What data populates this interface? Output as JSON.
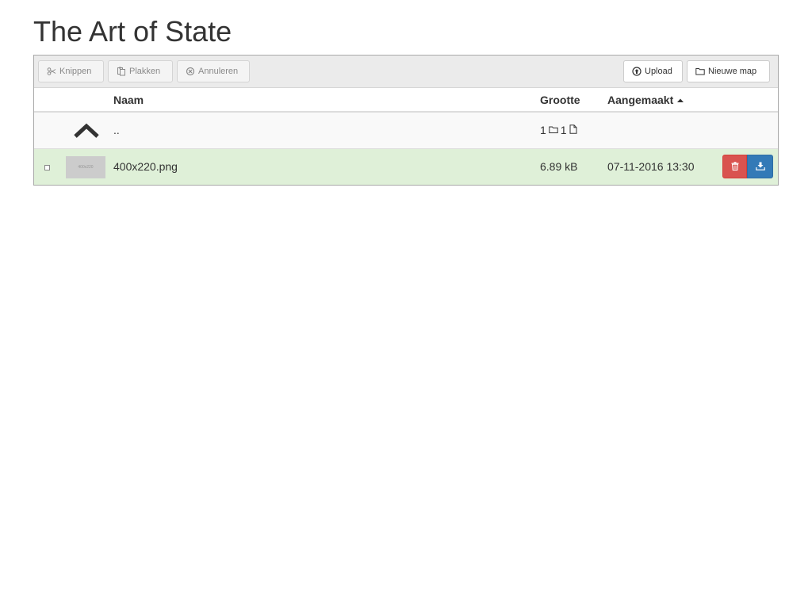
{
  "page": {
    "title": "The Art of State"
  },
  "toolbar": {
    "cut_label": "Knippen",
    "paste_label": "Plakken",
    "cancel_label": "Annuleren",
    "upload_label": "Upload",
    "new_folder_label": "Nieuwe map"
  },
  "table": {
    "columns": {
      "name": "Naam",
      "size": "Grootte",
      "created": "Aangemaakt"
    },
    "sort": {
      "column": "created",
      "direction": "ascending"
    },
    "parent_row": {
      "name": "..",
      "folder_count": "1",
      "file_count": "1"
    },
    "files": [
      {
        "name": "400x220.png",
        "thumbnail_label": "400x220",
        "size": "6.89 kB",
        "created": "07-11-2016 13:30",
        "selected_highlight": true
      }
    ]
  },
  "colors": {
    "toolbar_bg": "#ebebeb",
    "row_highlight": "#dff0d8",
    "delete_button": "#d9534f",
    "download_button": "#337ab7"
  },
  "icons": {
    "cut": "scissors-icon",
    "paste": "clipboard-icon",
    "cancel": "cancel-circle-icon",
    "upload": "upload-circle-icon",
    "new_folder": "folder-icon",
    "parent": "chevron-up-icon",
    "sort": "caret-up-icon",
    "delete": "trash-icon",
    "download": "download-icon"
  }
}
